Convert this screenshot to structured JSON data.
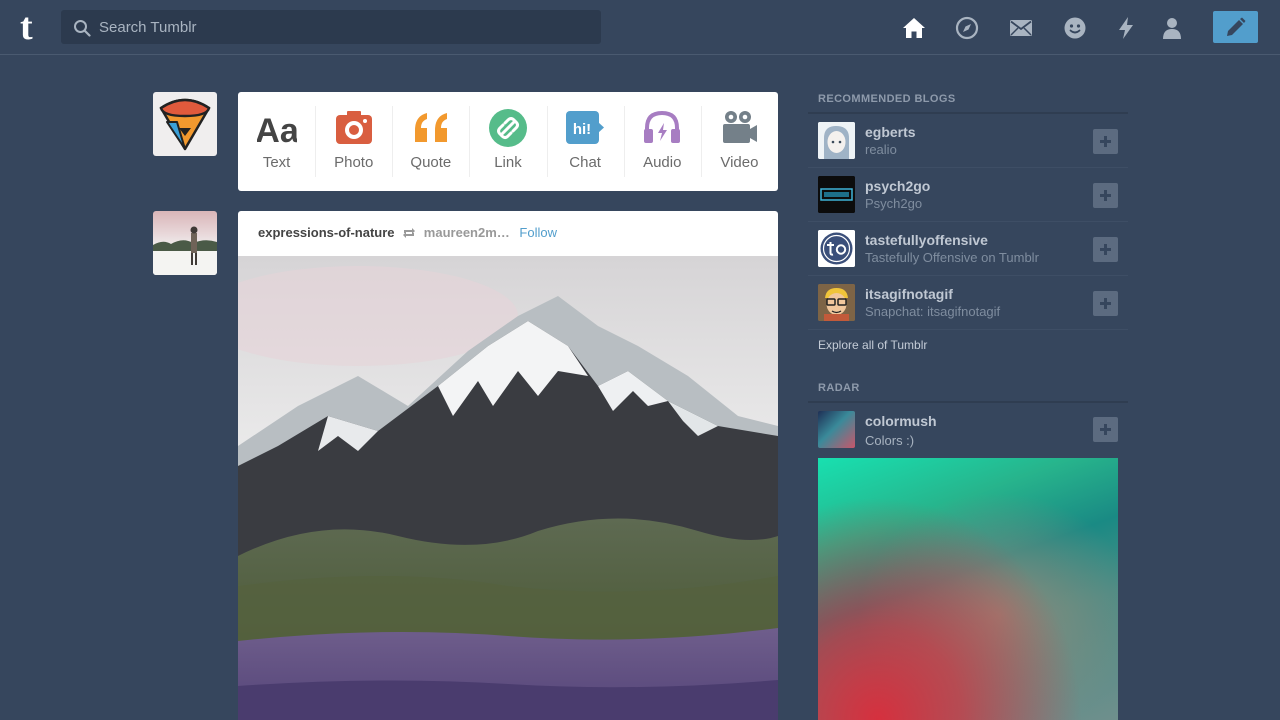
{
  "header": {
    "logo_letter": "t",
    "search_placeholder": "Search Tumblr",
    "nav": [
      "home-icon",
      "explore-icon",
      "inbox-icon",
      "messaging-icon",
      "activity-icon",
      "account-icon",
      "compose-icon"
    ]
  },
  "post_types": [
    {
      "label": "Text",
      "icon": "text-icon",
      "color": "#444444"
    },
    {
      "label": "Photo",
      "icon": "camera-icon",
      "color": "#d95e40"
    },
    {
      "label": "Quote",
      "icon": "quote-icon",
      "color": "#f2992e"
    },
    {
      "label": "Link",
      "icon": "link-icon",
      "color": "#56bc8a"
    },
    {
      "label": "Chat",
      "icon": "chat-icon",
      "color": "#529ecc"
    },
    {
      "label": "Audio",
      "icon": "headphones-icon",
      "color": "#a77dc2"
    },
    {
      "label": "Video",
      "icon": "video-camera-icon",
      "color": "#748089"
    }
  ],
  "post": {
    "blog": "expressions-of-nature",
    "source": "maureen2m…",
    "follow_label": "Follow"
  },
  "sidebar": {
    "recommended_title": "RECOMMENDED BLOGS",
    "recommended": [
      {
        "name": "egberts",
        "subtitle": "realio"
      },
      {
        "name": "psych2go",
        "subtitle": "Psych2go"
      },
      {
        "name": "tastefullyoffensive",
        "subtitle": "Tastefully Offensive on Tumblr"
      },
      {
        "name": "itsagifnotagif",
        "subtitle": "Snapchat: itsagifnotagif"
      }
    ],
    "explore_label": "Explore all of Tumblr",
    "radar_title": "RADAR",
    "radar": {
      "name": "colormush",
      "subtitle": "Colors :)"
    }
  },
  "colors": {
    "background": "#36465d",
    "accent": "#529ecc"
  }
}
